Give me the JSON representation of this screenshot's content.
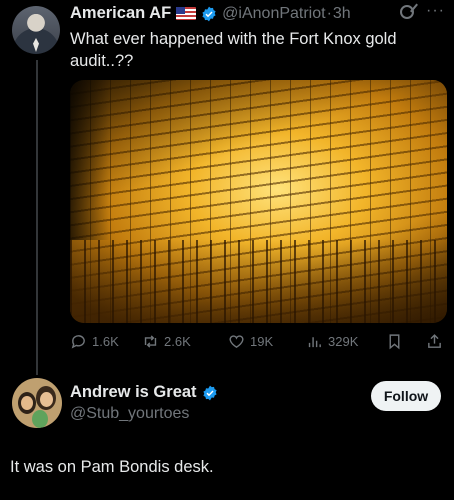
{
  "tweet": {
    "author_name": "American AF",
    "author_handle": "@iAnonPatriot",
    "separator": "·",
    "time": "3h",
    "more": "···",
    "text": "What ever happened with the Fort Knox gold audit..??",
    "media_icon": "gold-bars-photo"
  },
  "actions": {
    "replies": "1.6K",
    "reposts": "2.6K",
    "likes": "19K",
    "views": "329K"
  },
  "reply_account": {
    "name": "Andrew is Great",
    "handle": "@Stub_yourtoes",
    "follow_label": "Follow"
  },
  "reply_text": "It was on Pam Bondis desk.",
  "colors": {
    "background": "#000000",
    "primary_text": "#e7e9ea",
    "secondary_text": "#71767b",
    "verified": "#1d9bf0",
    "follow_bg": "#eff3f4"
  }
}
